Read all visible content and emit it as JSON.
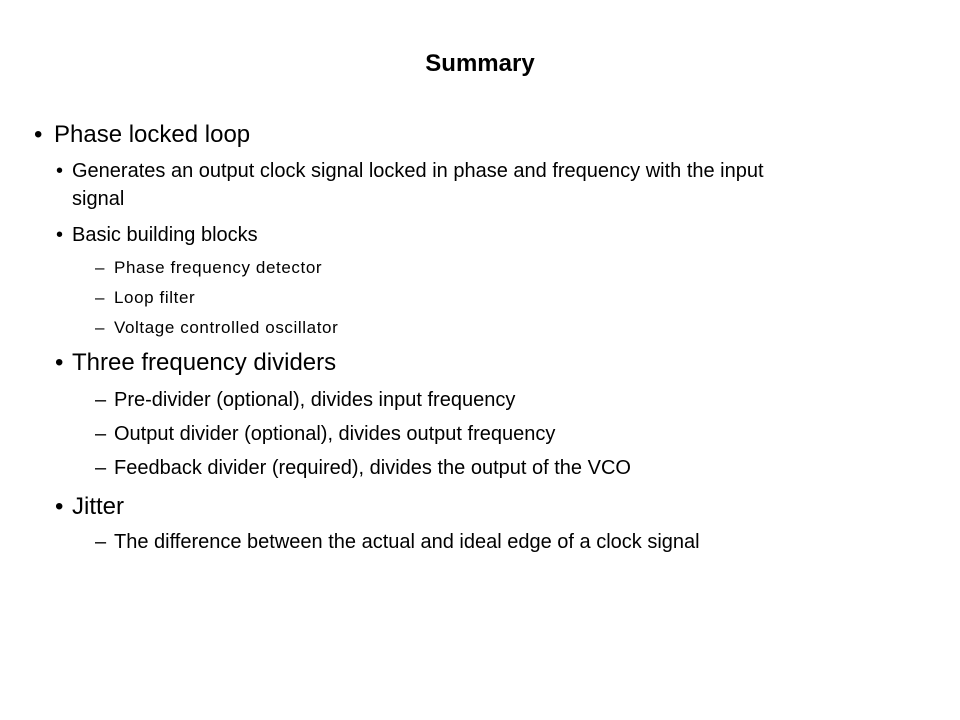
{
  "slide": {
    "title": "Summary",
    "items": [
      {
        "level": 1,
        "bullet": "•",
        "text": "Phase locked loop"
      },
      {
        "level": 2,
        "bullet": "•",
        "text": "Generates an output clock signal locked in phase and frequency with the input",
        "continuation": "signal"
      },
      {
        "level": 2,
        "bullet": "•",
        "text": "Basic building blocks"
      },
      {
        "level": 3,
        "bullet": "–",
        "text": "Phase frequency detector"
      },
      {
        "level": 3,
        "bullet": "–",
        "text": "Loop filter"
      },
      {
        "level": 3,
        "bullet": "–",
        "text": "Voltage controlled oscillator"
      },
      {
        "level": 2,
        "bullet": "•",
        "text": "Three frequency dividers"
      },
      {
        "level": 3,
        "bullet": "–",
        "text": "Pre-divider (optional), divides input frequency"
      },
      {
        "level": 3,
        "bullet": "–",
        "text": "Output divider (optional), divides output frequency"
      },
      {
        "level": 3,
        "bullet": "–",
        "text": "Feedback divider (required), divides the output of the VCO"
      },
      {
        "level": 2,
        "bullet": "•",
        "text": "Jitter"
      },
      {
        "level": 3,
        "bullet": "–",
        "text": "The difference between the actual and ideal edge of a clock signal"
      }
    ]
  }
}
